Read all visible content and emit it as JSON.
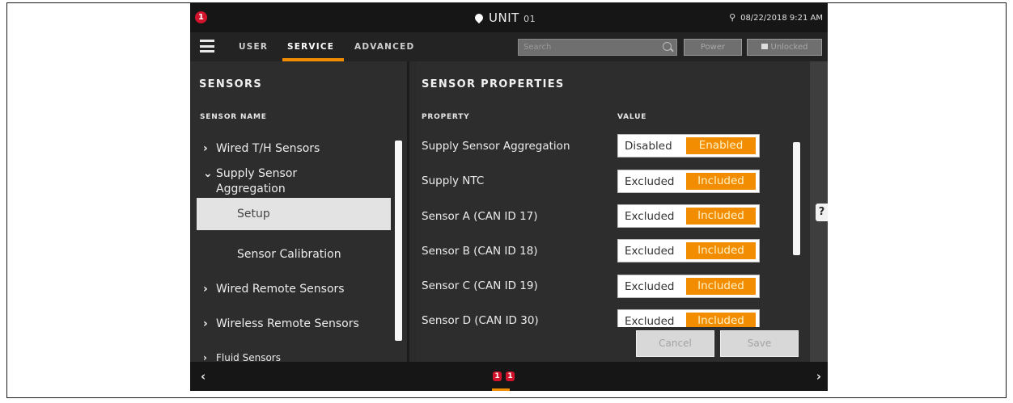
{
  "status": {
    "alert_count": "1",
    "unit_label": "UNIT",
    "unit_number": "01",
    "datetime": "08/22/2018 9:21 AM"
  },
  "nav": {
    "tabs": [
      {
        "label": "USER"
      },
      {
        "label": "SERVICE"
      },
      {
        "label": "ADVANCED"
      }
    ],
    "search_placeholder": "Search",
    "power_label": "Power",
    "lock_label": "Unlocked"
  },
  "sensors_panel": {
    "title": "SENSORS",
    "column_header": "SENSOR NAME",
    "items": [
      {
        "chevron": "›",
        "label": "Wired T/H Sensors"
      },
      {
        "chevron": "⌄",
        "label": "Supply Sensor Aggregation",
        "line1": "Supply Sensor",
        "line2": "Aggregation"
      },
      {
        "label": "Setup",
        "selected": true
      },
      {
        "label": "Sensor Calibration"
      },
      {
        "chevron": "›",
        "label": "Wired Remote Sensors"
      },
      {
        "chevron": "›",
        "label": "Wireless Remote Sensors"
      },
      {
        "chevron": "›",
        "label": "Fluid Sensors"
      }
    ]
  },
  "properties_panel": {
    "title": "SENSOR PROPERTIES",
    "col_property": "PROPERTY",
    "col_value": "VALUE",
    "rows": [
      {
        "property": "Supply Sensor Aggregation",
        "off": "Disabled",
        "on": "Enabled",
        "value": "Enabled"
      },
      {
        "property": "Supply NTC",
        "off": "Excluded",
        "on": "Included",
        "value": "Included"
      },
      {
        "property": "Sensor A (CAN ID 17)",
        "off": "Excluded",
        "on": "Included",
        "value": "Included"
      },
      {
        "property": "Sensor B (CAN ID 18)",
        "off": "Excluded",
        "on": "Included",
        "value": "Included"
      },
      {
        "property": "Sensor C (CAN ID 19)",
        "off": "Excluded",
        "on": "Included",
        "value": "Included"
      },
      {
        "property": "Sensor D (CAN ID 30)",
        "off": "Excluded",
        "on": "Included",
        "value": "Included"
      }
    ],
    "cancel_label": "Cancel",
    "save_label": "Save",
    "help_label": "?"
  },
  "bottom": {
    "prev": "‹",
    "next": "›",
    "alerts": [
      "1",
      "1"
    ]
  },
  "colors": {
    "accent": "#f28c00",
    "alert": "#d1142b",
    "panel_bg": "#2d2d2d"
  },
  "icons": [
    "alert-badge-icon",
    "location-pin-icon",
    "usb-icon",
    "hamburger-menu-icon",
    "search-icon",
    "lock-icon",
    "help-icon",
    "chevron-left-icon",
    "chevron-right-icon"
  ]
}
